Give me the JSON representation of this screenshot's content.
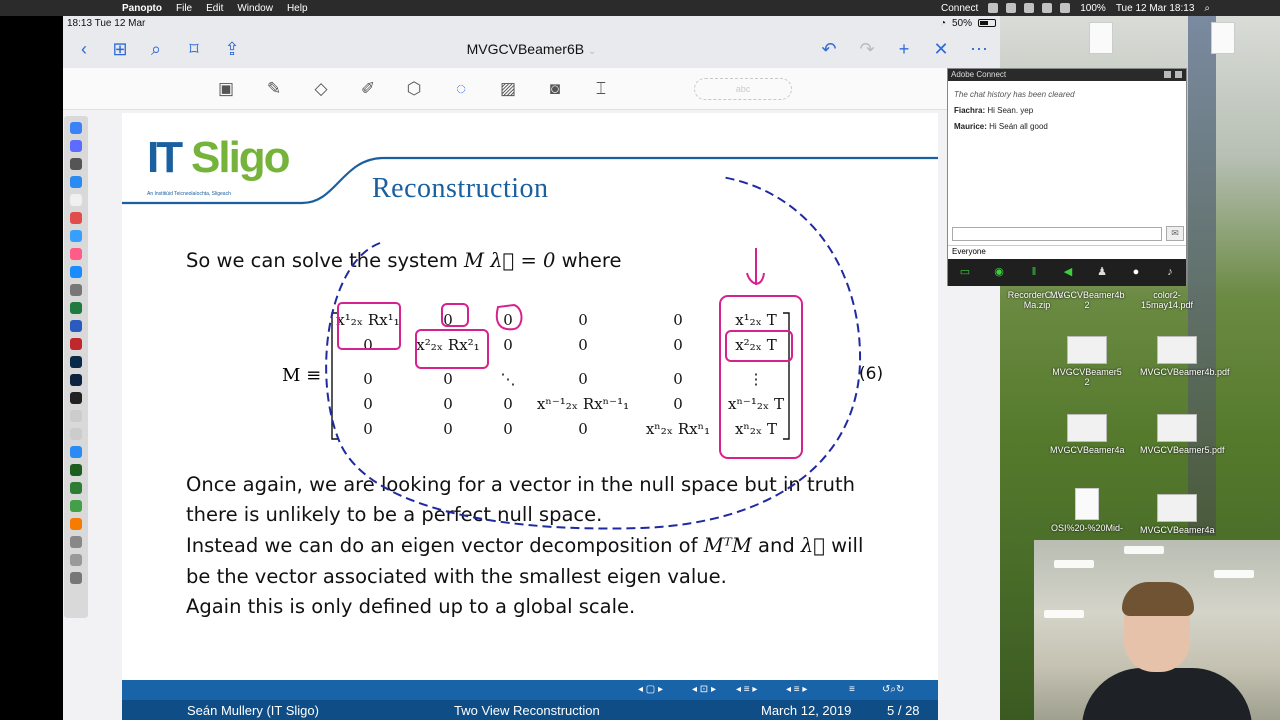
{
  "mac_menubar": {
    "app_name": "Panopto",
    "menus": [
      "File",
      "Edit",
      "Window",
      "Help"
    ],
    "connect": "Connect",
    "battery": "100%",
    "datetime": "Tue 12 Mar  18:13"
  },
  "ipad_status": {
    "time_date": "18:13  Tue 12 Mar",
    "battery": "50%"
  },
  "nav": {
    "title": "MVGCVBeamer6B"
  },
  "toolbar": {
    "lasso_placeholder": "abc"
  },
  "slide": {
    "logo_it": "IT",
    "logo_sligo": "Sligo",
    "logo_tagline": "An Institiúid Teicneolaíochta, Sligeach",
    "title": "Reconstruction",
    "line1_text": "So we can solve the system",
    "line1_math": "M λ⃗ = 0",
    "line1_tail": "where",
    "matrix_label": "M ≡",
    "equation_number": "(6)",
    "matrix_rows": [
      [
        "x¹₂ₓ Rx¹₁",
        "0",
        "0",
        "0",
        "0",
        "x¹₂ₓ T"
      ],
      [
        "0",
        "x²₂ₓ Rx²₁",
        "0",
        "0",
        "0",
        "x²₂ₓ T"
      ],
      [
        "0",
        "0",
        "⋱",
        "0",
        "0",
        "⋮"
      ],
      [
        "0",
        "0",
        "0",
        "xⁿ⁻¹₂ₓ Rxⁿ⁻¹₁",
        "0",
        "xⁿ⁻¹₂ₓ T"
      ],
      [
        "0",
        "0",
        "0",
        "0",
        "xⁿ₂ₓ Rxⁿ₁",
        "xⁿ₂ₓ T"
      ]
    ],
    "body": [
      "Once again, we are looking for a vector in the null space but in truth",
      "there is unlikely to be a perfect null space.",
      "Instead we can do an eigen vector decomposition of",
      "be the vector associated with the smallest eigen value.",
      "Again this is only defined up to a global scale."
    ],
    "body_math_mtm": "MᵀM",
    "body_and": "and",
    "body_lambda": "λ⃗",
    "body_will": "will",
    "footer": {
      "author": "Seán Mullery (IT Sligo)",
      "section": "Two View Reconstruction",
      "date": "March 12, 2019",
      "page": "5 / 28"
    }
  },
  "adobe_connect": {
    "title": "Adobe Connect",
    "cleared": "The chat history has been cleared",
    "messages": [
      {
        "user": "Fiachra:",
        "text": "Hi Sean. yep"
      },
      {
        "user": "Maurice:",
        "text": "Hi Seán all good"
      }
    ],
    "audience": "Everyone"
  },
  "desktop_files": [
    {
      "name": "RecorderC...s-Ma.zip"
    },
    {
      "name": "MVGCVBeamer4b 2"
    },
    {
      "name": "color2-15may14.pdf"
    },
    {
      "name": "MVGCVBeamer5 2"
    },
    {
      "name": "MVGCVBeamer4b.pdf"
    },
    {
      "name": "MVGCVBeamer4a"
    },
    {
      "name": "MVGCVBeamer5.pdf"
    },
    {
      "name": "OSI%20-%20Mid-"
    },
    {
      "name": "MVGCVBeamer4a"
    }
  ],
  "colors": {
    "accent": "#2f6bd8",
    "slide_blue": "#1a5fa0",
    "ink_pink": "#d6228f",
    "ink_navy": "#1f2aa0"
  }
}
